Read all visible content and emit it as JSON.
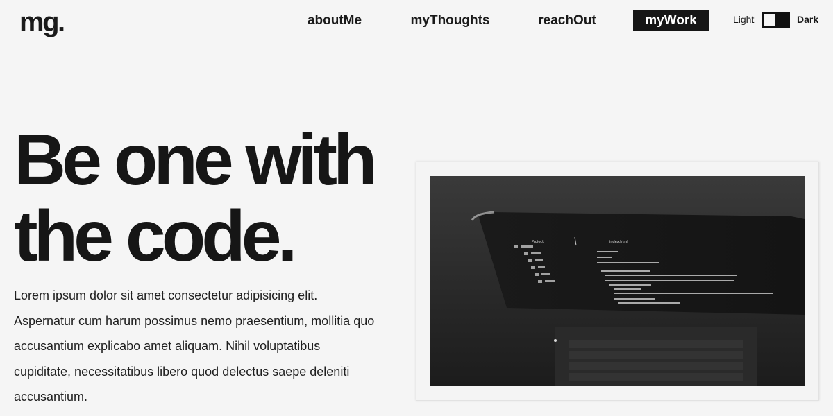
{
  "header": {
    "logo": "mg.",
    "nav": [
      {
        "label": "aboutMe",
        "active": false
      },
      {
        "label": "myThoughts",
        "active": false
      },
      {
        "label": "reachOut",
        "active": false
      },
      {
        "label": "myWork",
        "active": true
      }
    ],
    "theme_toggle": {
      "light_label": "Light",
      "dark_label": "Dark",
      "state": "light"
    }
  },
  "hero": {
    "headline_line1": "Be one with",
    "headline_line2": "the code.",
    "description": "Lorem ipsum dolor sit amet consectetur adipisicing elit. Aspernatur cum harum possimus nemo praesentium, mollitia quo accusantium explicabo amet aliquam. Nihil voluptatibus cupiditate, necessitatibus libero quod delectus saepe deleniti accusantium.",
    "image": {
      "subject": "laptop showing code editor",
      "visible_text": {
        "sidebar_title": "Project",
        "tab_title": "index.html"
      }
    }
  },
  "colors": {
    "background": "#f5f5f5",
    "text": "#161616",
    "active_nav_bg": "#161616",
    "active_nav_text": "#ffffff"
  }
}
